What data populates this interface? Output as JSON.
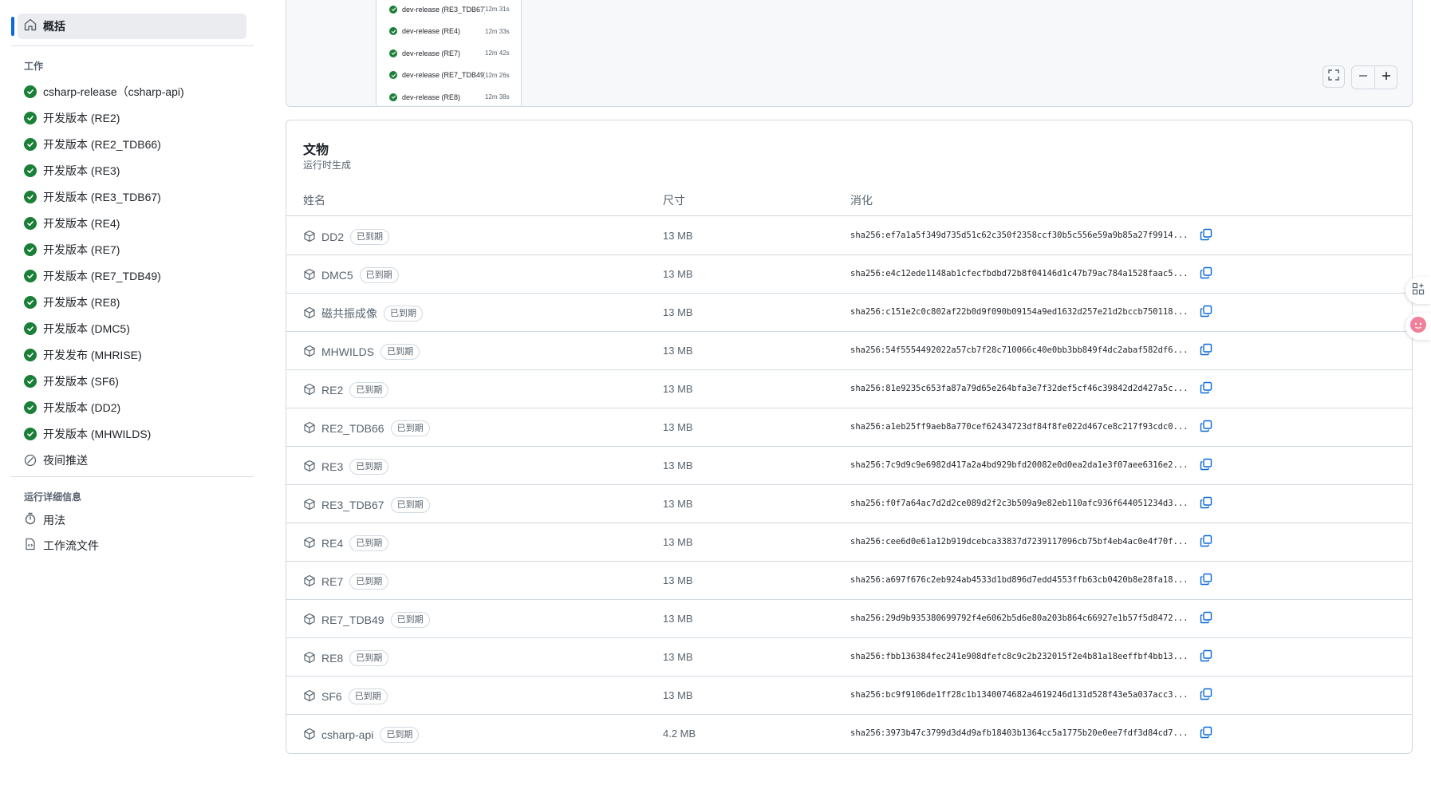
{
  "sidebar": {
    "summary_label": "概括",
    "jobs_title": "工作",
    "jobs": [
      {
        "label": "csharp-release（csharp-api)",
        "status": "success"
      },
      {
        "label": "开发版本 (RE2)",
        "status": "success"
      },
      {
        "label": "开发版本 (RE2_TDB66)",
        "status": "success"
      },
      {
        "label": "开发版本 (RE3)",
        "status": "success"
      },
      {
        "label": "开发版本 (RE3_TDB67)",
        "status": "success"
      },
      {
        "label": "开发版本 (RE4)",
        "status": "success"
      },
      {
        "label": "开发版本 (RE7)",
        "status": "success"
      },
      {
        "label": "开发版本 (RE7_TDB49)",
        "status": "success"
      },
      {
        "label": "开发版本 (RE8)",
        "status": "success"
      },
      {
        "label": "开发版本 (DMC5)",
        "status": "success"
      },
      {
        "label": "开发发布 (MHRISE)",
        "status": "success"
      },
      {
        "label": "开发版本 (SF6)",
        "status": "success"
      },
      {
        "label": "开发版本 (DD2)",
        "status": "success"
      },
      {
        "label": "开发版本 (MHWILDS)",
        "status": "success"
      },
      {
        "label": "夜间推送",
        "status": "skipped"
      }
    ],
    "details_title": "运行详细信息",
    "usage_label": "用法",
    "workflow_file_label": "工作流文件"
  },
  "graph": {
    "jobs": [
      {
        "name": "dev-release (RE3_TDB67)",
        "duration": "12m 31s"
      },
      {
        "name": "dev-release (RE4)",
        "duration": "12m 33s"
      },
      {
        "name": "dev-release (RE7)",
        "duration": "12m 42s"
      },
      {
        "name": "dev-release (RE7_TDB49)",
        "duration": "12m 26s"
      },
      {
        "name": "dev-release (RE8)",
        "duration": "12m 38s"
      }
    ]
  },
  "artifacts": {
    "title": "文物",
    "subtitle": "运行时生成",
    "col_name": "姓名",
    "col_size": "尺寸",
    "col_digest": "消化",
    "expired_label": "已到期",
    "rows": [
      {
        "name": "DD2",
        "size": "13 MB",
        "digest": "sha256:ef7a1a5f349d735d51c62c350f2358ccf30b5c556e59a9b85a27f9914..."
      },
      {
        "name": "DMC5",
        "size": "13 MB",
        "digest": "sha256:e4c12ede1148ab1cfecfbdbd72b8f04146d1c47b79ac784a1528faac5..."
      },
      {
        "name": "磁共振成像",
        "size": "13 MB",
        "digest": "sha256:c151e2c0c802af22b0d9f090b09154a9ed1632d257e21d2bccb750118..."
      },
      {
        "name": "MHWILDS",
        "size": "13 MB",
        "digest": "sha256:54f5554492022a57cb7f28c710066c40e0bb3bb849f4dc2abaf582df6..."
      },
      {
        "name": "RE2",
        "size": "13 MB",
        "digest": "sha256:81e9235c653fa87a79d65e264bfa3e7f32def5cf46c39842d2d427a5c..."
      },
      {
        "name": "RE2_TDB66",
        "size": "13 MB",
        "digest": "sha256:a1eb25ff9aeb8a770cef62434723df84f8fe022d467ce8c217f93cdc0..."
      },
      {
        "name": "RE3",
        "size": "13 MB",
        "digest": "sha256:7c9d9c9e6982d417a2a4bd929bfd20082e0d0ea2da1e3f07aee6316e2..."
      },
      {
        "name": "RE3_TDB67",
        "size": "13 MB",
        "digest": "sha256:f0f7a64ac7d2d2ce089d2f2c3b509a9e82eb110afc936f644051234d3..."
      },
      {
        "name": "RE4",
        "size": "13 MB",
        "digest": "sha256:cee6d0e61a12b919dcebca33837d7239117096cb75bf4eb4ac0e4f70f..."
      },
      {
        "name": "RE7",
        "size": "13 MB",
        "digest": "sha256:a697f676c2eb924ab4533d1bd896d7edd4553ffb63cb0420b8e28fa18..."
      },
      {
        "name": "RE7_TDB49",
        "size": "13 MB",
        "digest": "sha256:29d9b935380699792f4e6062b5d6e80a203b864c66927e1b57f5d8472..."
      },
      {
        "name": "RE8",
        "size": "13 MB",
        "digest": "sha256:fbb136384fec241e908dfefc8c9c2b232015f2e4b81a18eeffbf4bb13..."
      },
      {
        "name": "SF6",
        "size": "13 MB",
        "digest": "sha256:bc9f9106de1ff28c1b1340074682a4619246d131d528f43e5a037acc3..."
      },
      {
        "name": "csharp-api",
        "size": "4.2 MB",
        "digest": "sha256:3973b47c3799d3d4d9afb18403b1364cc5a1775b20e0ee7fdf3d84cd7..."
      }
    ]
  },
  "icons": {
    "summary": "home-icon",
    "job_success": "check-circle-icon",
    "job_skipped": "skip-icon",
    "usage": "stopwatch-icon",
    "workflow_file": "file-code-icon",
    "artifact": "package-icon",
    "copy": "copy-icon",
    "fullscreen": "fullscreen-icon",
    "zoom_out": "zoom-out-icon",
    "zoom_in": "zoom-in-icon"
  },
  "colors": {
    "success": "#1a7f37",
    "accent": "#0969da"
  }
}
